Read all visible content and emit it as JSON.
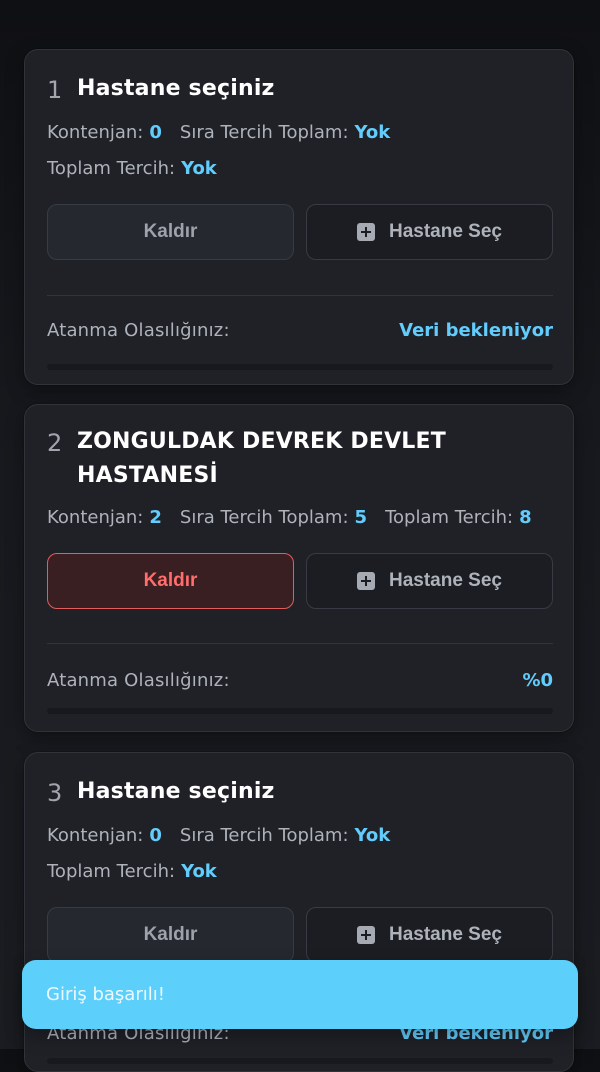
{
  "cards": [
    {
      "index": "1",
      "title": "Hastane seçiniz",
      "stats_line_1": [
        {
          "label": "Kontenjan:",
          "value": "0"
        },
        {
          "label": "Sıra Tercih Toplam:",
          "value": "Yok"
        }
      ],
      "stats_line_2": [
        {
          "label": "Toplam Tercih:",
          "value": "Yok"
        }
      ],
      "remove_label": "Kaldır",
      "select_label": "Hastane Seç",
      "probability_label": "Atanma Olasılığınız:",
      "probability_value": "Veri bekleniyor"
    },
    {
      "index": "2",
      "title": "ZONGULDAK DEVREK DEVLET HASTANESİ",
      "stats_line_1": [
        {
          "label": "Kontenjan:",
          "value": "2"
        },
        {
          "label": "Sıra Tercih Toplam:",
          "value": "5"
        },
        {
          "label": "Toplam Tercih:",
          "value": "8"
        }
      ],
      "remove_label": "Kaldır",
      "select_label": "Hastane Seç",
      "probability_label": "Atanma Olasılığınız:",
      "probability_value": "%0"
    },
    {
      "index": "3",
      "title": "Hastane seçiniz",
      "stats_line_1": [
        {
          "label": "Kontenjan:",
          "value": "0"
        },
        {
          "label": "Sıra Tercih Toplam:",
          "value": "Yok"
        }
      ],
      "stats_line_2": [
        {
          "label": "Toplam Tercih:",
          "value": "Yok"
        }
      ],
      "remove_label": "Kaldır",
      "select_label": "Hastane Seç",
      "probability_label": "Atanma Olasılığınız:",
      "probability_value": "Veri bekleniyor"
    }
  ],
  "toast": {
    "message": "Giriş başarılı!"
  },
  "icons": {
    "hospital_select_icon": "plus-square-icon"
  },
  "colors": {
    "accent": "#62cdfd",
    "danger": "#ff6d6d",
    "toast_bg": "#5ccffb",
    "card_bg": "#1f2127"
  }
}
